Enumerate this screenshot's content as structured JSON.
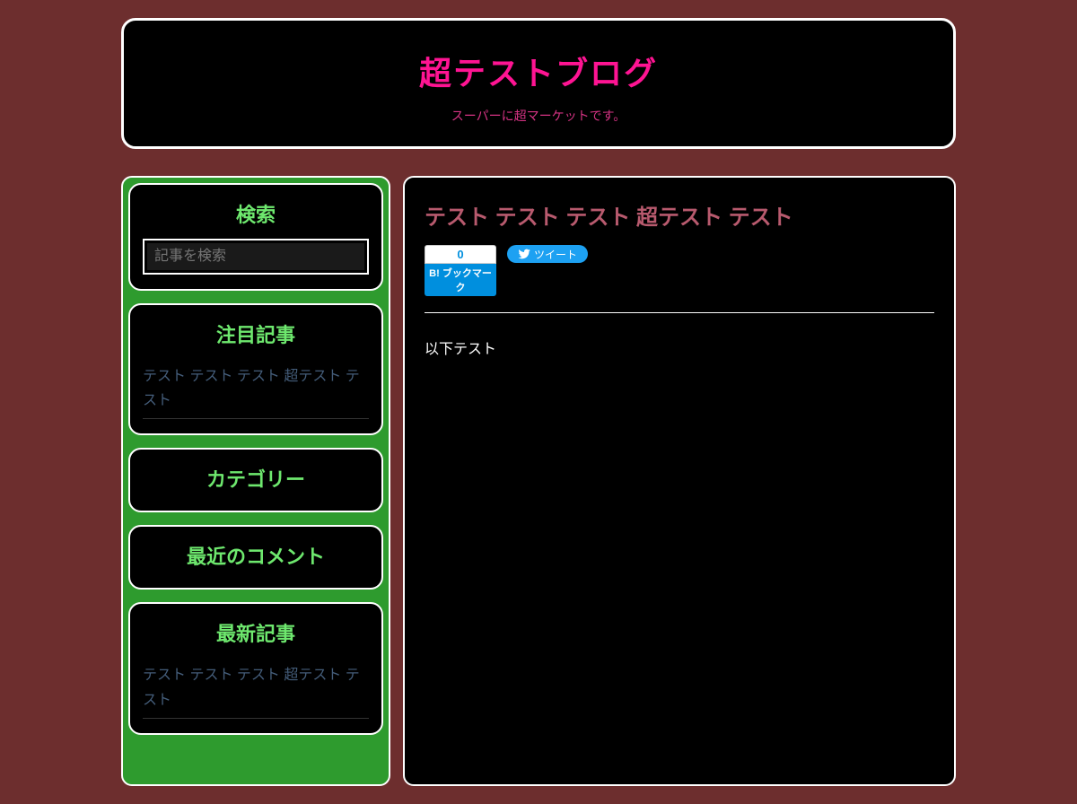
{
  "header": {
    "title": "超テストブログ",
    "subtitle": "スーパーに超マーケットです。"
  },
  "sidebar": {
    "search": {
      "title": "検索",
      "placeholder": "記事を検索"
    },
    "featured": {
      "title": "注目記事",
      "link": "テスト テスト テスト 超テスト テスト"
    },
    "categories": {
      "title": "カテゴリー"
    },
    "recent_comments": {
      "title": "最近のコメント"
    },
    "recent_posts": {
      "title": "最新記事",
      "link": "テスト テスト テスト 超テスト テスト"
    }
  },
  "post": {
    "title": "テスト テスト テスト 超テスト テスト",
    "hatena_count": "0",
    "hatena_label": "B! ブックマーク",
    "tweet_label": "ツイート",
    "body": "以下テスト"
  }
}
